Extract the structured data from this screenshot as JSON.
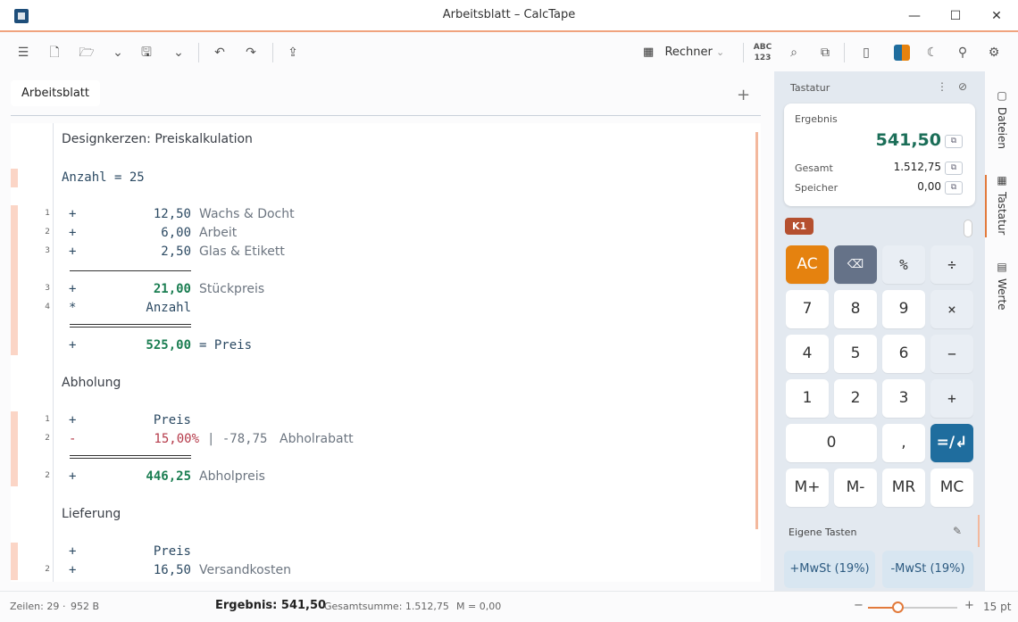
{
  "window": {
    "title": "Arbeitsblatt  –  CalcTape"
  },
  "toolbar": {
    "calculator_mode": "Rechner"
  },
  "tabs": [
    {
      "label": "Arbeitsblatt"
    }
  ],
  "editor": {
    "heading_1": "Designkerzen: Preiskalkulation",
    "anzahl_line": "Anzahl = 25",
    "rows_a": [
      {
        "num": "1",
        "op": "+",
        "value": "12,50",
        "comment": "Wachs & Docht"
      },
      {
        "num": "2",
        "op": "+",
        "value": "6,00",
        "comment": "Arbeit"
      },
      {
        "num": "3",
        "op": "+",
        "value": "2,50",
        "comment": "Glas & Etikett"
      }
    ],
    "stueck": {
      "num": "3",
      "op": "+",
      "value": "21,00",
      "comment": "Stückpreis"
    },
    "mult": {
      "num": "4",
      "op": "*",
      "value": "Anzahl"
    },
    "preis": {
      "op": "+",
      "value": "525,00",
      "text": "= Preis"
    },
    "heading_2": "Abholung",
    "abh_1": {
      "num": "1",
      "op": "+",
      "value": "Preis"
    },
    "abh_2": {
      "num": "2",
      "op": "-",
      "value": "15,00%",
      "extra": "| -78,75",
      "comment": "Abholrabatt"
    },
    "abh_res": {
      "num": "2",
      "op": "+",
      "value": "446,25",
      "comment": "Abholpreis"
    },
    "heading_3": "Lieferung",
    "lief_1": {
      "op": "+",
      "value": "Preis"
    },
    "lief_2": {
      "num": "2",
      "op": "+",
      "value": "16,50",
      "comment": "Versandkosten"
    }
  },
  "status": {
    "lines": "Zeilen: 29",
    "size": "952 B",
    "result": "Ergebnis: 541,50",
    "total": "Gesamtsumme: 1.512,75",
    "memory": "M = 0,00",
    "zoom_minus": "−",
    "zoom_plus": "+",
    "font_size": "15 pt",
    "zoom_level_fraction": 0.33
  },
  "panel": {
    "title": "Tastatur",
    "result_label": "Ergebnis",
    "result_value": "541,50",
    "total_label": "Gesamt",
    "total_value": "1.512,75",
    "memory_label": "Speicher",
    "memory_value": "0,00",
    "register": "K1",
    "keys": {
      "ac": "AC",
      "percent": "%",
      "divide": "÷",
      "k7": "7",
      "k8": "8",
      "k9": "9",
      "multiply": "×",
      "k4": "4",
      "k5": "5",
      "k6": "6",
      "minus": "−",
      "k1": "1",
      "k2": "2",
      "k3": "3",
      "plus": "+",
      "k0": "0",
      "comma": ",",
      "enter": "=/↲",
      "mplus": "M+",
      "mminus": "M-",
      "mr": "MR",
      "mc": "MC"
    },
    "own_keys_title": "Eigene Tasten",
    "own_keys": [
      "+MwSt (19%)",
      "-MwSt (19%)"
    ]
  },
  "sidetabs": [
    "Dateien",
    "Tastatur",
    "Werte"
  ],
  "colors": {
    "accent": "#e27a3b",
    "result_green": "#1b7e52",
    "enter_key": "#1f6d9e",
    "ac_key": "#e5820f"
  }
}
